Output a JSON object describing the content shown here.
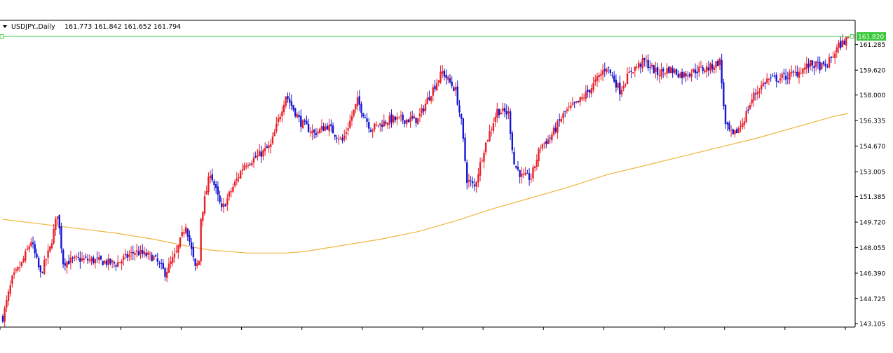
{
  "header": {
    "symbol_label": "USDJPY.,Daily",
    "ohlc_text": "161.773 161.842 161.652 161.794"
  },
  "price_label": "161.820",
  "colors": {
    "bull": "#e8202a",
    "bear": "#1414d2",
    "ma": "#f0b540",
    "price_line": "#3cc83c",
    "axis": "#000000"
  },
  "chart_data": {
    "type": "candlestick",
    "title": "USDJPY.,Daily",
    "xlabel": "",
    "ylabel": "",
    "ylim": [
      143.105,
      161.82
    ],
    "y_ticks": [
      "161.285",
      "159.620",
      "158.000",
      "156.335",
      "154.670",
      "153.005",
      "151.385",
      "149.720",
      "148.055",
      "146.390",
      "144.725",
      "143.105"
    ],
    "current_price": 161.82,
    "last_ohlc": {
      "open": 161.773,
      "high": 161.842,
      "low": 161.652,
      "close": 161.794
    },
    "ohlc_anchors": [
      [
        0,
        143.5
      ],
      [
        5,
        146.0
      ],
      [
        10,
        147.0
      ],
      [
        15,
        148.5
      ],
      [
        20,
        146.3
      ],
      [
        25,
        148.0
      ],
      [
        29,
        150.3
      ],
      [
        32,
        147.1
      ],
      [
        40,
        147.3
      ],
      [
        50,
        147.2
      ],
      [
        60,
        147.0
      ],
      [
        70,
        147.8
      ],
      [
        80,
        147.4
      ],
      [
        86,
        146.4
      ],
      [
        92,
        147.7
      ],
      [
        97,
        149.6
      ],
      [
        102,
        146.7
      ],
      [
        104,
        147.2
      ],
      [
        105,
        150.0
      ],
      [
        110,
        153.0
      ],
      [
        116,
        150.5
      ],
      [
        122,
        152.0
      ],
      [
        128,
        153.5
      ],
      [
        135,
        154.0
      ],
      [
        142,
        154.7
      ],
      [
        150,
        158.0
      ],
      [
        158,
        156.2
      ],
      [
        165,
        155.5
      ],
      [
        172,
        156.0
      ],
      [
        180,
        155.0
      ],
      [
        188,
        157.6
      ],
      [
        195,
        155.8
      ],
      [
        205,
        156.4
      ],
      [
        220,
        156.4
      ],
      [
        227,
        158.2
      ],
      [
        233,
        159.5
      ],
      [
        240,
        158.3
      ],
      [
        243,
        156.2
      ],
      [
        246,
        152.5
      ],
      [
        250,
        152.0
      ],
      [
        255,
        154.5
      ],
      [
        262,
        157.0
      ],
      [
        268,
        156.8
      ],
      [
        271,
        153.5
      ],
      [
        275,
        152.7
      ],
      [
        280,
        152.6
      ],
      [
        285,
        154.7
      ],
      [
        290,
        155.2
      ],
      [
        298,
        156.9
      ],
      [
        305,
        157.5
      ],
      [
        312,
        158.5
      ],
      [
        320,
        159.9
      ],
      [
        327,
        158.3
      ],
      [
        333,
        159.6
      ],
      [
        340,
        160.2
      ],
      [
        347,
        159.4
      ],
      [
        353,
        159.7
      ],
      [
        360,
        159.3
      ],
      [
        367,
        159.6
      ],
      [
        375,
        159.8
      ],
      [
        380,
        160.2
      ],
      [
        383,
        156.0
      ],
      [
        387,
        155.3
      ],
      [
        392,
        156.2
      ],
      [
        398,
        158.0
      ],
      [
        405,
        159.0
      ],
      [
        412,
        159.1
      ],
      [
        420,
        159.4
      ],
      [
        428,
        160.0
      ],
      [
        436,
        159.8
      ],
      [
        443,
        161.2
      ],
      [
        448,
        161.7
      ]
    ],
    "moving_average": [
      [
        0,
        149.9
      ],
      [
        20,
        149.6
      ],
      [
        40,
        149.3
      ],
      [
        60,
        149.0
      ],
      [
        80,
        148.6
      ],
      [
        100,
        148.1
      ],
      [
        110,
        147.9
      ],
      [
        130,
        147.7
      ],
      [
        150,
        147.7
      ],
      [
        160,
        147.8
      ],
      [
        180,
        148.2
      ],
      [
        200,
        148.6
      ],
      [
        220,
        149.1
      ],
      [
        240,
        149.8
      ],
      [
        260,
        150.6
      ],
      [
        280,
        151.3
      ],
      [
        300,
        152.0
      ],
      [
        320,
        152.8
      ],
      [
        340,
        153.4
      ],
      [
        360,
        154.0
      ],
      [
        380,
        154.6
      ],
      [
        400,
        155.2
      ],
      [
        420,
        155.9
      ],
      [
        440,
        156.6
      ],
      [
        448,
        156.8
      ]
    ]
  }
}
